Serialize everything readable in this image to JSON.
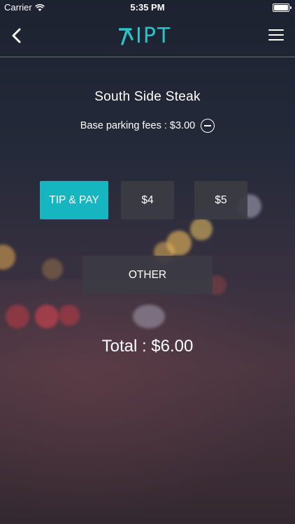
{
  "status_bar": {
    "carrier": "Carrier",
    "time": "5:35 PM",
    "icons": [
      "wifi-icon",
      "battery-icon"
    ]
  },
  "nav": {
    "logo_text": "IPT",
    "back_icon": "chevron-left-icon",
    "menu_icon": "hamburger-menu-icon"
  },
  "venue": {
    "name": "South Side Steak"
  },
  "base_fee": {
    "label": "Base parking fees : $3.00",
    "action_icon": "minus-circle-icon"
  },
  "tip_options": {
    "primary_label": "TIP & PAY",
    "option_1": "$4",
    "option_2": "$5",
    "other": "OTHER"
  },
  "total": {
    "label": "Total : $6.00"
  },
  "colors": {
    "accent": "#15b6c0",
    "logo": "#2cc3c6",
    "button_dark": "#3c3c44",
    "text": "#ffffff"
  }
}
